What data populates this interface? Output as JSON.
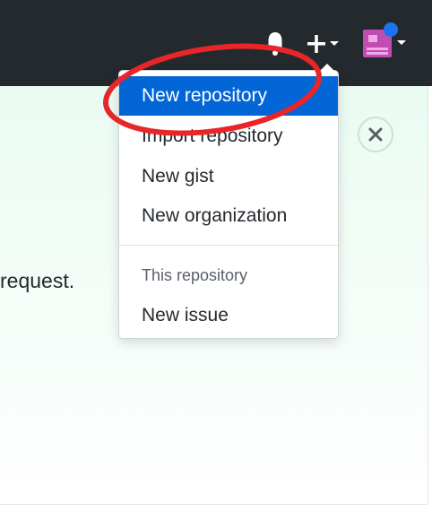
{
  "header_bar": {
    "icons": {
      "bell": "bell-icon",
      "plus": "plus-icon",
      "caret": "caret-down-icon",
      "avatar": "avatar",
      "notification": "notification-dot"
    },
    "colors": {
      "background": "#24292e",
      "icon": "#ffffff",
      "avatar": "#c24db2",
      "notification_dot": "#1a73f0"
    }
  },
  "page": {
    "partial_text": "request.",
    "close_icon": "close-icon"
  },
  "dropdown": {
    "items": [
      {
        "label": "New repository",
        "active": true
      },
      {
        "label": "Import repository"
      },
      {
        "label": "New gist"
      },
      {
        "label": "New organization"
      }
    ],
    "section_header": "This repository",
    "section_items": [
      {
        "label": "New issue"
      }
    ],
    "colors": {
      "active_bg": "#0366d6",
      "active_text": "#ffffff"
    }
  },
  "annotation": {
    "shape": "ellipse",
    "color": "#e8262a"
  }
}
